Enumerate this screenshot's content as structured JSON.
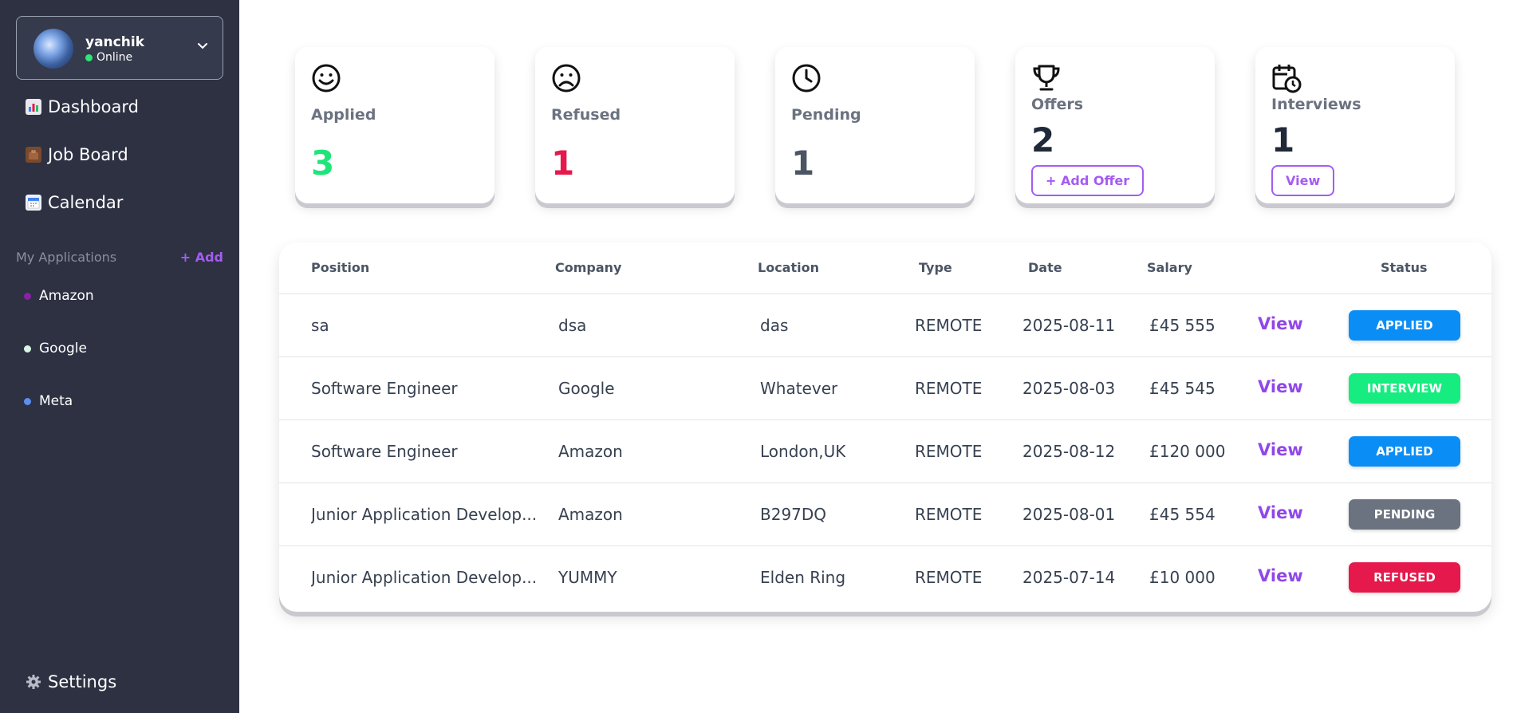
{
  "user": {
    "name": "yanchik",
    "status": "Online"
  },
  "nav": [
    {
      "label": "Dashboard",
      "icon": "chart-icon"
    },
    {
      "label": "Job Board",
      "icon": "briefcase-icon"
    },
    {
      "label": "Calendar",
      "icon": "calendar-icon"
    }
  ],
  "applications_section": {
    "label": "My Applications",
    "add_label": "+ Add"
  },
  "applications": [
    {
      "label": "Amazon",
      "color": "#8b1fa8"
    },
    {
      "label": "Google",
      "color": "#d9f5e3"
    },
    {
      "label": "Meta",
      "color": "#5b8ff0"
    }
  ],
  "settings": {
    "label": "Settings"
  },
  "stats": {
    "applied": {
      "label": "Applied",
      "value": "3",
      "color": "#1ee57a"
    },
    "refused": {
      "label": "Refused",
      "value": "1",
      "color": "#e5194b"
    },
    "pending": {
      "label": "Pending",
      "value": "1",
      "color": "#4b5563"
    },
    "offers": {
      "label": "Offers",
      "value": "2",
      "button": "+ Add Offer"
    },
    "interviews": {
      "label": "Interviews",
      "value": "1",
      "button": "View"
    }
  },
  "table": {
    "headers": {
      "position": "Position",
      "company": "Company",
      "location": "Location",
      "type": "Type",
      "date": "Date",
      "salary": "Salary",
      "status": "Status"
    },
    "view_label": "View",
    "rows": [
      {
        "position": "sa",
        "company": "dsa",
        "location": "das",
        "type": "REMOTE",
        "date": "2025-08-11",
        "salary": "£45 555",
        "status": "APPLIED",
        "status_color": "#0a8ef5"
      },
      {
        "position": "Software Engineer",
        "company": "Google",
        "location": "Whatever",
        "type": "REMOTE",
        "date": "2025-08-03",
        "salary": "£45 545",
        "status": "INTERVIEW",
        "status_color": "#16ec7f"
      },
      {
        "position": "Software Engineer",
        "company": "Amazon",
        "location": "London,UK",
        "type": "REMOTE",
        "date": "2025-08-12",
        "salary": "£120 000",
        "status": "APPLIED",
        "status_color": "#0a8ef5"
      },
      {
        "position": "Junior Application Develop...",
        "company": "Amazon",
        "location": "B297DQ",
        "type": "REMOTE",
        "date": "2025-08-01",
        "salary": "£45 554",
        "status": "PENDING",
        "status_color": "#6b7280"
      },
      {
        "position": "Junior Application Develop...",
        "company": "YUMMY",
        "location": "Elden Ring",
        "type": "REMOTE",
        "date": "2025-07-14",
        "salary": "£10 000",
        "status": "REFUSED",
        "status_color": "#e5194b"
      }
    ]
  }
}
